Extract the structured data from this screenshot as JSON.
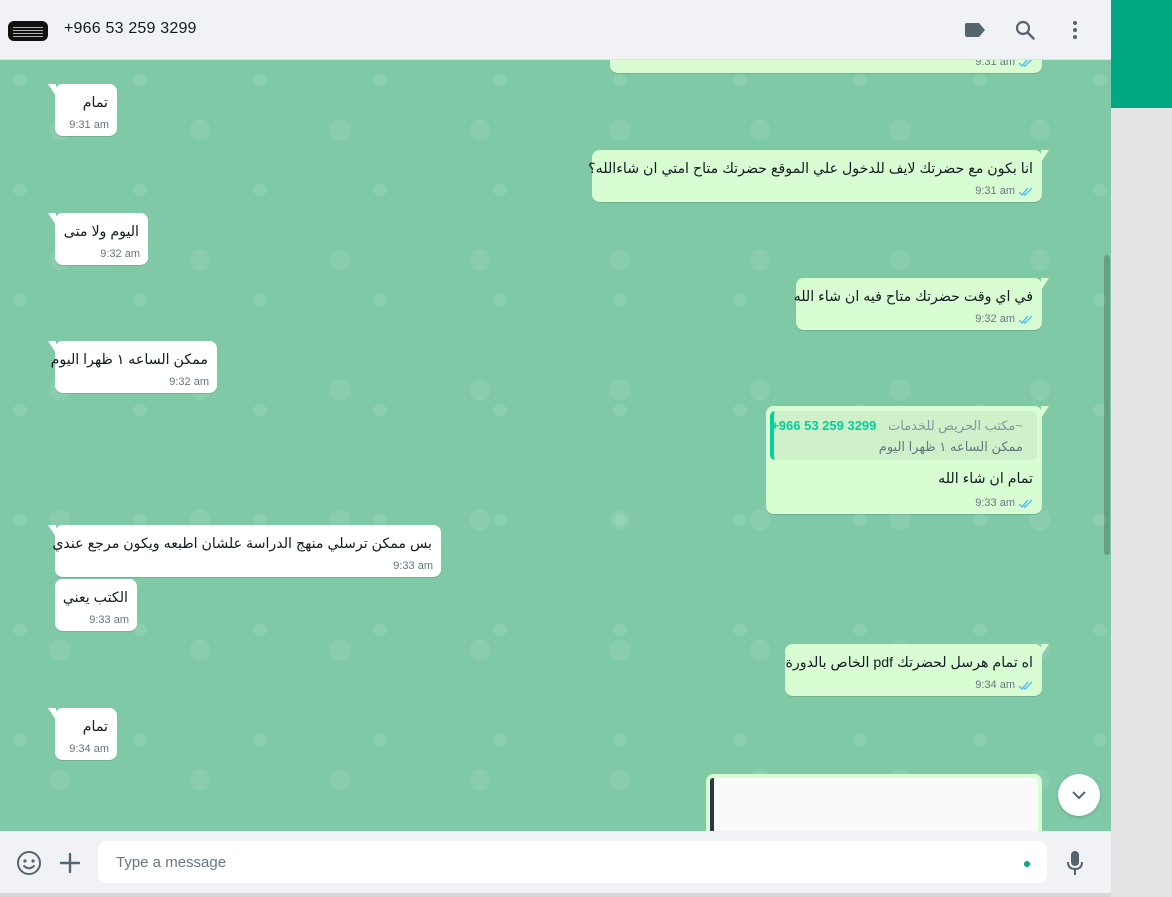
{
  "header": {
    "contact_name": "+966 53 259 3299"
  },
  "messages": [
    {
      "id": "m0",
      "dir": "out",
      "text": "",
      "time": "9:31 am"
    },
    {
      "id": "m1",
      "dir": "in",
      "text": "تمام",
      "time": "9:31 am"
    },
    {
      "id": "m2",
      "dir": "out",
      "text": "انا بكون مع حضرتك لايف للدخول علي الموقع حضرتك متاح امتي ان شاءالله؟",
      "time": "9:31 am"
    },
    {
      "id": "m3",
      "dir": "in",
      "text": "اليوم ولا متى",
      "time": "9:32 am"
    },
    {
      "id": "m4",
      "dir": "out",
      "text": "في اي وقت حضرتك متاح فيه ان شاء الله",
      "time": "9:32 am"
    },
    {
      "id": "m5",
      "dir": "in",
      "text": "ممكن الساعه ١ ظهرا اليوم",
      "time": "9:32 am"
    },
    {
      "id": "m6",
      "dir": "out",
      "text": "تمام ان شاء الله",
      "time": "9:33 am",
      "quote": {
        "author": "~مكتب الحريص للخدمات",
        "phone": "+966 53 259 3299",
        "text": "ممكن الساعه ١ ظهرا اليوم"
      }
    },
    {
      "id": "m7",
      "dir": "in",
      "text": "بس ممكن ترسلي منهج الدراسة علشان اطبعه ويكون مرجع عندي",
      "time": "9:33 am"
    },
    {
      "id": "m8",
      "dir": "in",
      "text": "الكتب يعني",
      "time": "9:33 am"
    },
    {
      "id": "m9",
      "dir": "out",
      "text": "اه تمام هرسل لحضرتك pdf الخاص بالدورة",
      "time": "9:34 am"
    },
    {
      "id": "m10",
      "dir": "in",
      "text": "تمام",
      "time": "9:34 am"
    }
  ],
  "composer": {
    "placeholder": "Type a message"
  },
  "icons": {
    "header": [
      "label-icon",
      "search-icon",
      "menu-dots-icon"
    ],
    "footer": [
      "emoji-icon",
      "attach-plus-icon",
      "microphone-icon"
    ],
    "scroll": "chevron-down-icon"
  },
  "colors": {
    "accent": "#00a884",
    "chat_background": "#7fc9a7",
    "outgoing_bubble": "#d9fdd3",
    "incoming_bubble": "#ffffff",
    "read_ticks": "#53bdeb"
  }
}
